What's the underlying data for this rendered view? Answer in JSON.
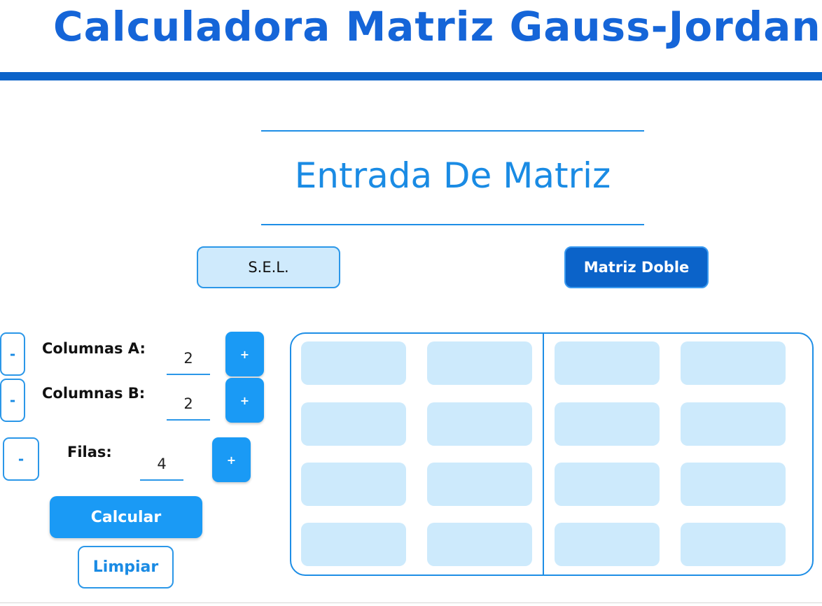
{
  "header": {
    "title": "Calculadora Matriz Gauss-Jordan"
  },
  "section": {
    "title": "Entrada De Matriz"
  },
  "modes": {
    "sel_label": "S.E.L.",
    "doble_label": "Matriz Doble"
  },
  "controls": {
    "minus_label": "-",
    "plus_label": "+",
    "columnas_a": {
      "label": "Columnas A:",
      "value": "2"
    },
    "columnas_b": {
      "label": "Columnas B:",
      "value": "2"
    },
    "filas": {
      "label": "Filas:",
      "value": "4"
    },
    "calcular_label": "Calcular",
    "limpiar_label": "Limpiar"
  },
  "matrix": {
    "rows": 4,
    "cols_a": 2,
    "cols_b": 2
  },
  "colors": {
    "primary": "#0b63c9",
    "accent": "#1a9af5",
    "cell_fill": "#cdeafc"
  }
}
